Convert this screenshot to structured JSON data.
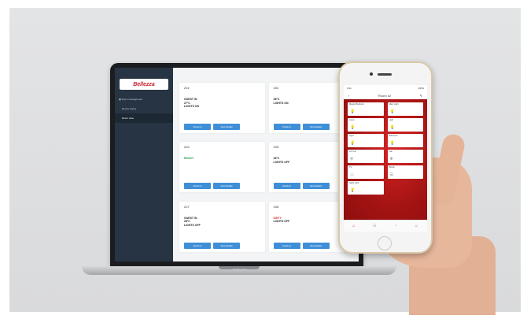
{
  "laptop": {
    "brand_logo": "Bellezza",
    "sidebar": {
      "section_label": "Room management",
      "items": [
        {
          "label": "Device status"
        },
        {
          "label": "Room view"
        }
      ]
    },
    "rooms": [
      {
        "number": "201",
        "lines": [
          "GUEST IN",
          "27°C",
          "LIGHTS ON"
        ],
        "status": "",
        "buttons": [
          "Check-in",
          "View Details"
        ]
      },
      {
        "number": "202",
        "lines": [
          "28°C",
          "LIGHTS ON"
        ],
        "status": "",
        "buttons": [
          "Check-in",
          "View Details"
        ]
      },
      {
        "number": "204",
        "lines": [],
        "status": "READY",
        "buttons": [
          "Check-in",
          "View Details"
        ]
      },
      {
        "number": "205",
        "lines": [
          "26°C",
          "LIGHTS OFF"
        ],
        "status": "",
        "buttons": [
          "Check-in",
          "View Details"
        ]
      },
      {
        "number": "207",
        "lines": [
          "GUEST IN",
          "28°C",
          "LIGHTS OFF"
        ],
        "status": "",
        "buttons": [
          "Check-in",
          "View Details"
        ]
      },
      {
        "number": "208",
        "lines": [
          "LIGHTS OFF"
        ],
        "status": "DIRTY",
        "buttons": [
          "Check-in",
          "View Details"
        ]
      }
    ],
    "base_label": "MacBook Pro"
  },
  "phone": {
    "status_time": "9:41",
    "status_right": "100%",
    "header_title": "Room 42",
    "tiles": [
      {
        "label": "Master Bedroom",
        "icon": "💡"
      },
      {
        "label": "Main Light",
        "icon": "💡"
      },
      {
        "label": "Lamp",
        "icon": "💡"
      },
      {
        "label": "Light",
        "icon": "💡"
      },
      {
        "label": "Light",
        "icon": "💡"
      },
      {
        "label": "Bathroom",
        "icon": "💡"
      },
      {
        "label": "AC Unit",
        "icon": "❄"
      },
      {
        "label": "Fan",
        "icon": "✻"
      },
      {
        "label": "TV",
        "icon": "▭"
      },
      {
        "label": "Blinds",
        "icon": "☰"
      },
      {
        "label": "Night Light",
        "icon": "💡"
      }
    ],
    "tabs": [
      {
        "icon": "⌂",
        "active": true
      },
      {
        "icon": "☷",
        "active": false
      },
      {
        "icon": "◔",
        "active": false
      },
      {
        "icon": "☺",
        "active": false
      }
    ]
  },
  "colors": {
    "sidebar": "#273443",
    "button": "#3f8fd8",
    "phone_accent": "#d42424",
    "ready": "#22a34a",
    "dirty": "#d62d2d"
  }
}
